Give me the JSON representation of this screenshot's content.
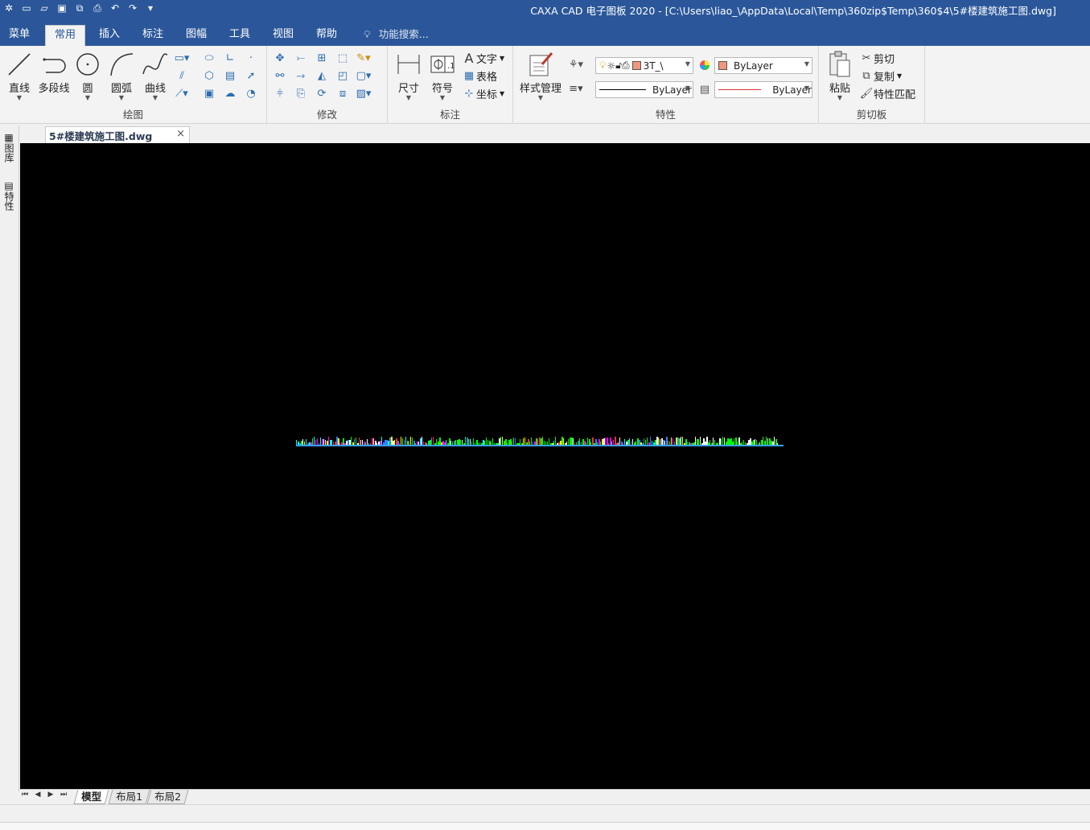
{
  "window": {
    "title": "CAXA CAD 电子图板 2020 - [C:\\Users\\liao_\\AppData\\Local\\Temp\\360zip$Temp\\360$4\\5#楼建筑施工图.dwg]"
  },
  "quick_access": [
    "app-logo-icon",
    "new-file-icon",
    "open-file-icon",
    "save-icon",
    "save-all-icon",
    "print-icon",
    "undo-icon",
    "redo-icon",
    "customize-icon"
  ],
  "ribbon_tabs": {
    "menu": "菜单",
    "home": "常用",
    "insert": "插入",
    "annotate": "标注",
    "sheet": "图幅",
    "tools": "工具",
    "view": "视图",
    "help": "帮助",
    "search": "功能搜索..."
  },
  "draw_group": {
    "label": "绘图",
    "line": "直线",
    "polyline": "多段线",
    "circle": "圆",
    "arc": "圆弧",
    "curve": "曲线"
  },
  "modify_group": {
    "label": "修改"
  },
  "annotate_group": {
    "label": "标注",
    "dimension": "尺寸",
    "symbol": "符号",
    "text": "文字",
    "table": "表格",
    "coordinate": "坐标"
  },
  "style_group": {
    "style_manager": "样式管理"
  },
  "properties_group": {
    "label": "特性",
    "layer_value": "3T_\\",
    "color_value": "ByLayer",
    "linetype_value": "ByLayer",
    "lineweight_value": "ByLayer",
    "accent_color": "#e03030"
  },
  "clipboard_group": {
    "label": "剪切板",
    "paste": "粘贴",
    "cut": "剪切",
    "copy": "复制",
    "match_properties": "特性匹配"
  },
  "left_dock": {
    "library": "图库",
    "properties": "特性"
  },
  "document": {
    "tab_name": "5#楼建筑施工图.dwg",
    "close_symbol": "×"
  },
  "layout_tabs": [
    "模型",
    "布局1",
    "布局2"
  ]
}
